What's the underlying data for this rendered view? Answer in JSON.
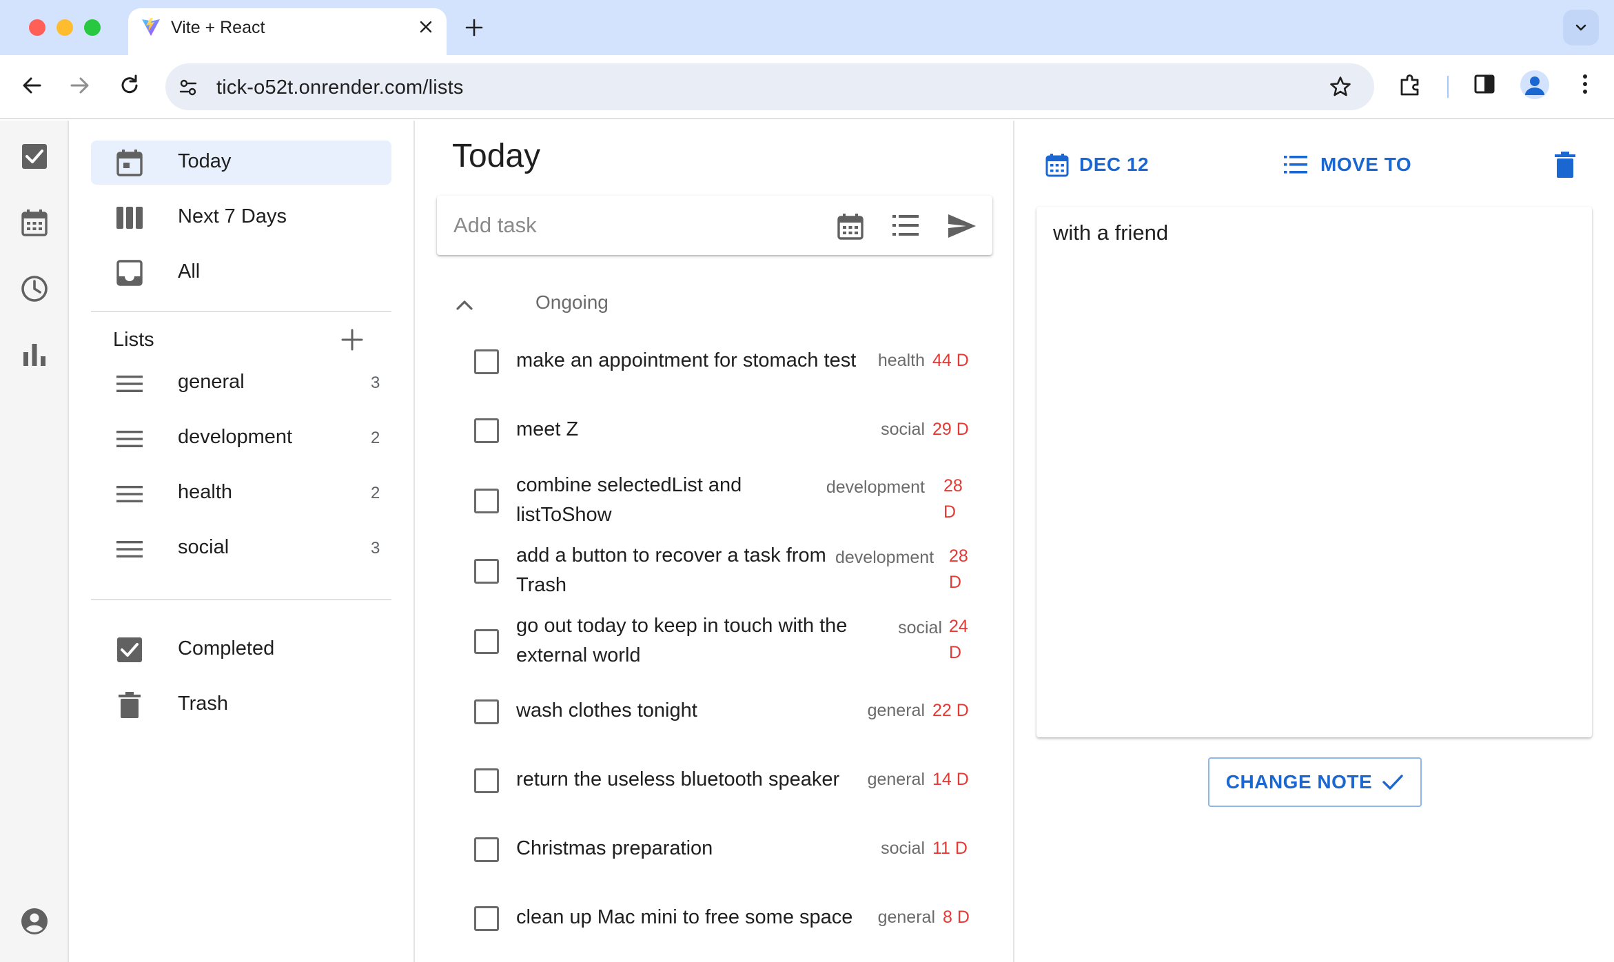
{
  "browser": {
    "tab_title": "Vite + React",
    "url": "tick-o52t.onrender.com/lists",
    "traffic_colors": [
      "#ff5f57",
      "#febc2e",
      "#28c840"
    ]
  },
  "rail": {
    "items": [
      "checkbox-icon",
      "calendar-icon",
      "clock-icon",
      "bar-chart-icon",
      "account-icon"
    ]
  },
  "sidebar": {
    "smart_lists": [
      {
        "label": "Today",
        "icon": "calendar-today-icon"
      },
      {
        "label": "Next 7 Days",
        "icon": "view-week-icon"
      },
      {
        "label": "All",
        "icon": "inbox-icon"
      }
    ],
    "lists_heading": "Lists",
    "lists": [
      {
        "label": "general",
        "count": "3"
      },
      {
        "label": "development",
        "count": "2"
      },
      {
        "label": "health",
        "count": "2"
      },
      {
        "label": "social",
        "count": "3"
      }
    ],
    "bottom": [
      {
        "label": "Completed",
        "icon": "check-box-icon"
      },
      {
        "label": "Trash",
        "icon": "trash-icon"
      }
    ]
  },
  "main": {
    "title": "Today",
    "add_placeholder": "Add task",
    "group_label": "Ongoing",
    "tasks": [
      {
        "text": "make an appointment for stomach test",
        "tag": "health",
        "due": "44 D"
      },
      {
        "text": "meet Z",
        "tag": "social",
        "due": "29 D"
      },
      {
        "text": "combine selectedList and listToShow",
        "tag": "development",
        "due": "28 D"
      },
      {
        "text": "add a button to recover a task from Trash",
        "tag": "development",
        "due": "28 D"
      },
      {
        "text": "go out today to keep in touch with the external world",
        "tag": "social",
        "due": "24 D"
      },
      {
        "text": "wash clothes tonight",
        "tag": "general",
        "due": "22 D"
      },
      {
        "text": "return the useless bluetooth speaker",
        "tag": "general",
        "due": "14 D"
      },
      {
        "text": "Christmas preparation",
        "tag": "social",
        "due": "11 D"
      },
      {
        "text": "clean up Mac mini to free some space",
        "tag": "general",
        "due": "8 D"
      }
    ]
  },
  "detail": {
    "date_label": "DEC 12",
    "move_label": "MOVE TO",
    "note": "with a friend",
    "change_label": "CHANGE NOTE"
  },
  "colors": {
    "accent": "#1a67d2",
    "due": "#e53935",
    "active_bg": "#e8f0fe"
  }
}
